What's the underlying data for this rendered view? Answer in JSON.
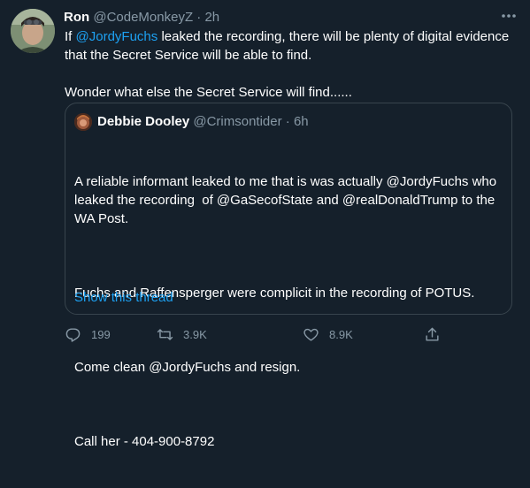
{
  "tweet": {
    "author_name": "Ron",
    "author_handle": "@CodeMonkeyZ",
    "separator": "·",
    "time": "2h",
    "text_part1_prefix": "If ",
    "text_mention": "@JordyFuchs",
    "text_part1_suffix": " leaked the recording, there will be plenty of digital evidence that the Secret Service will be able to find.",
    "text_part2": "Wonder what else the Secret Service will find......"
  },
  "quoted_tweet": {
    "author_name": "Debbie Dooley",
    "author_handle": "@Crimsontider",
    "separator": "·",
    "time": "6h",
    "para1": "A reliable informant leaked to me that is was actually @JordyFuchs who leaked the recording  of @GaSecofState and @realDonaldTrump to the WA Post.",
    "para2": "Fuchs and Raffensperger were complicit in the recording of POTUS.",
    "para3": "Come clean @JordyFuchs and resign.",
    "para4": "Call her - 404-900-8792",
    "show_thread": "Show this thread"
  },
  "actions": {
    "reply_count": "199",
    "retweet_count": "3.9K",
    "like_count": "8.9K"
  },
  "icons": {
    "more": "more-horizontal-icon",
    "reply": "reply-icon",
    "retweet": "retweet-icon",
    "like": "heart-icon",
    "share": "share-icon"
  },
  "colors": {
    "background": "#15202b",
    "link": "#1da1f2",
    "secondary_text": "#8899a6",
    "border": "#38444d"
  }
}
